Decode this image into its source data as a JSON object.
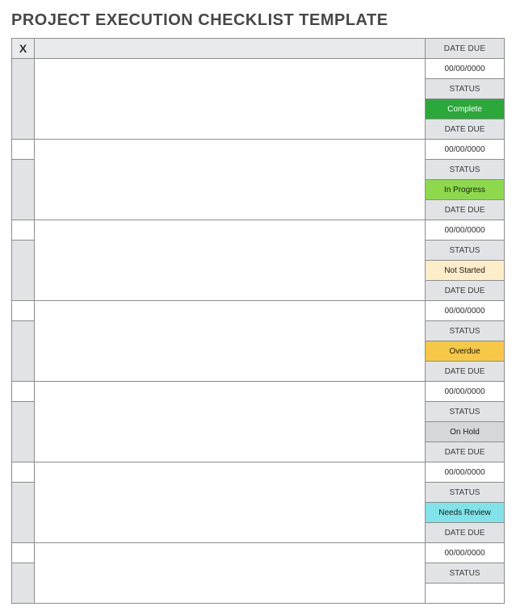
{
  "title": "PROJECT EXECUTION CHECKLIST TEMPLATE",
  "header": {
    "x": "X",
    "date_due": "DATE DUE"
  },
  "labels": {
    "date_due": "DATE DUE",
    "status": "STATUS"
  },
  "rows": [
    {
      "date": "00/00/0000",
      "status": "Complete",
      "status_bg": "#2aa83a",
      "status_fg": "#ffffff"
    },
    {
      "date": "00/00/0000",
      "status": "In Progress",
      "status_bg": "#8dd94b",
      "status_fg": "#1b1b1b"
    },
    {
      "date": "00/00/0000",
      "status": "Not Started",
      "status_bg": "#fdedc9",
      "status_fg": "#1b1b1b"
    },
    {
      "date": "00/00/0000",
      "status": "Overdue",
      "status_bg": "#f6c845",
      "status_fg": "#1b1b1b"
    },
    {
      "date": "00/00/0000",
      "status": "On Hold",
      "status_bg": "#d5d7da",
      "status_fg": "#1b1b1b"
    },
    {
      "date": "00/00/0000",
      "status": "Needs Review",
      "status_bg": "#7fe3e9",
      "status_fg": "#1b1b1b"
    },
    {
      "date": "00/00/0000",
      "status": "",
      "status_bg": "",
      "status_fg": ""
    }
  ]
}
